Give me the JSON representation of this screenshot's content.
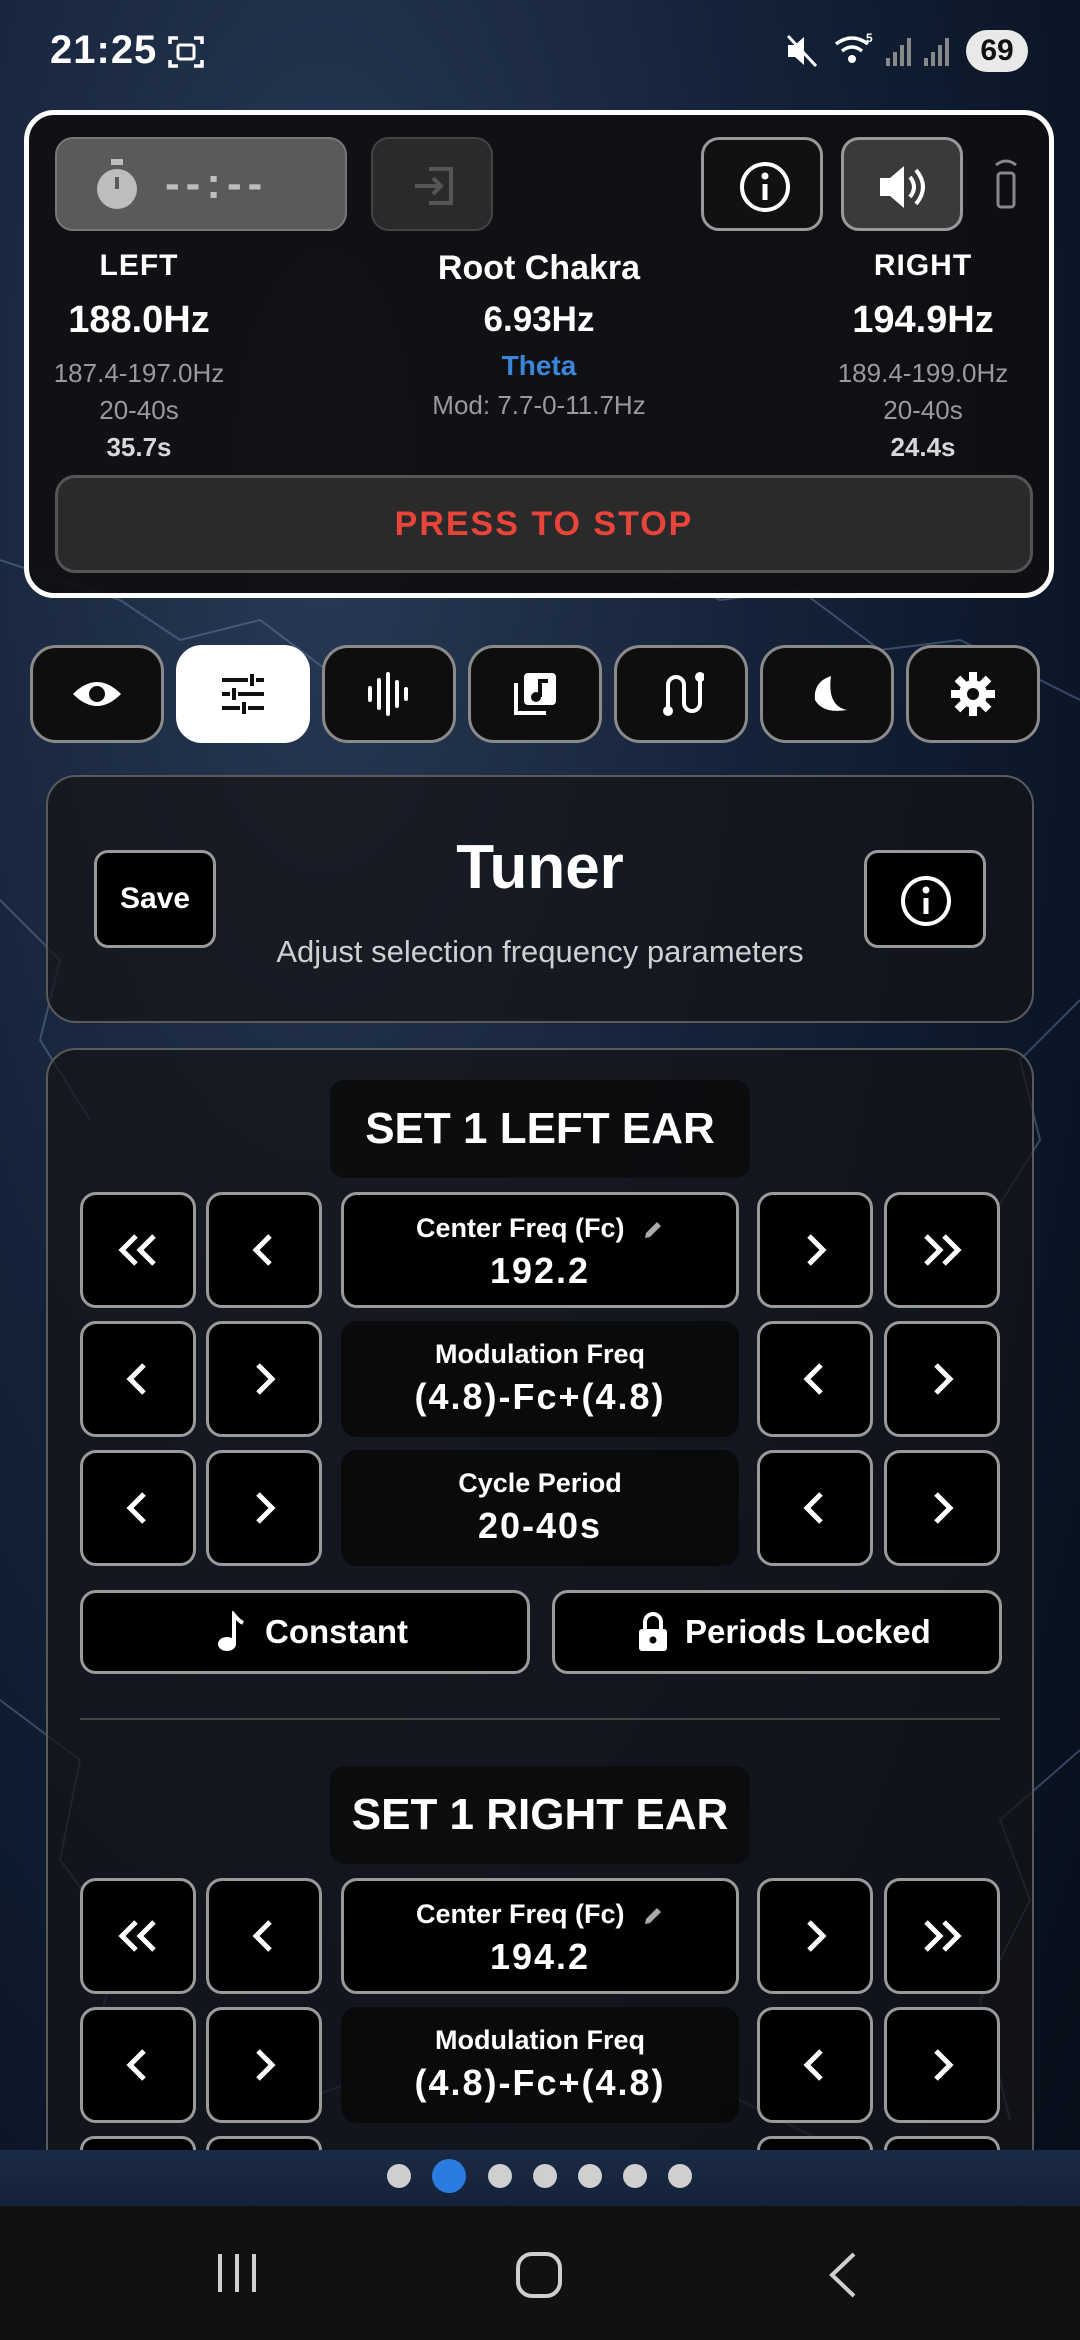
{
  "status_bar": {
    "time": "21:25",
    "battery": "69"
  },
  "player": {
    "timer": "--:--",
    "left": {
      "label": "LEFT",
      "freq": "188.0Hz",
      "range": "187.4-197.0Hz",
      "period": "20-40s",
      "elapsed": "35.7s"
    },
    "center": {
      "preset": "Root Chakra",
      "beat": "6.93Hz",
      "band": "Theta",
      "mod": "Mod: 7.7-0-11.7Hz"
    },
    "right": {
      "label": "RIGHT",
      "freq": "194.9Hz",
      "range": "189.4-199.0Hz",
      "period": "20-40s",
      "elapsed": "24.4s"
    },
    "stop_label": "PRESS TO STOP"
  },
  "tabs": [
    {
      "icon": "eye-icon",
      "active": false
    },
    {
      "icon": "sliders-icon",
      "active": true
    },
    {
      "icon": "waveform-icon",
      "active": false
    },
    {
      "icon": "music-library-icon",
      "active": false
    },
    {
      "icon": "route-icon",
      "active": false
    },
    {
      "icon": "moon-icon",
      "active": false
    },
    {
      "icon": "gear-icon",
      "active": false
    }
  ],
  "tuner": {
    "save_label": "Save",
    "title": "Tuner",
    "subtitle": "Adjust selection frequency parameters"
  },
  "set_left": {
    "title": "SET 1 LEFT EAR",
    "center_label": "Center Freq (Fc)",
    "center_value": "192.2",
    "mod_label": "Modulation Freq",
    "mod_value": "(4.8)-Fc+(4.8)",
    "cycle_label": "Cycle Period",
    "cycle_value": "20-40s",
    "constant_label": "Constant",
    "locked_label": "Periods Locked"
  },
  "set_right": {
    "title": "SET 1 RIGHT EAR",
    "center_label": "Center Freq (Fc)",
    "center_value": "194.2",
    "mod_label": "Modulation Freq",
    "mod_value": "(4.8)-Fc+(4.8)"
  },
  "pager": {
    "count": 7,
    "current": 2
  },
  "colors": {
    "accent_blue": "#2c7be0",
    "stop_red": "#e8443a",
    "theta_blue": "#3b86d8"
  }
}
